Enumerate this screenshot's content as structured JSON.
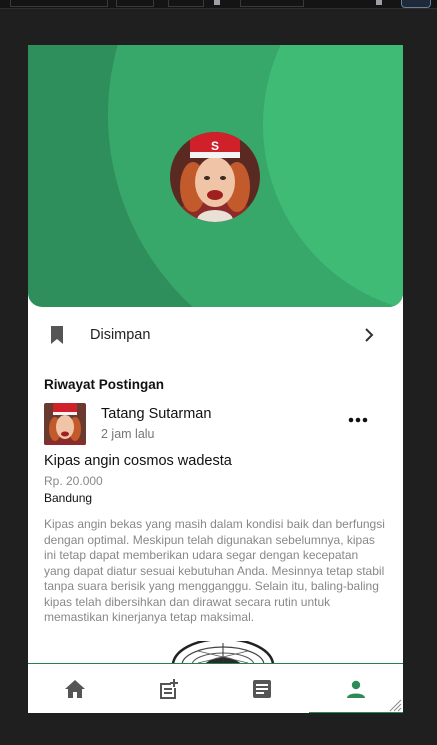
{
  "colors": {
    "header_dark": "#2f8f5c",
    "header_mid": "#37a76a",
    "header_light": "#3fbb76",
    "accent": "#2e8b57",
    "icon_gray": "#555555"
  },
  "profile": {
    "avatar_icon": "profile-photo"
  },
  "menu": {
    "saved_label": "Disimpan",
    "saved_icon": "bookmark-icon",
    "arrow_icon": "chevron-right-icon"
  },
  "history": {
    "section_title": "Riwayat Postingan",
    "post": {
      "author": "Tatang Sutarman",
      "time": "2 jam lalu",
      "title": "Kipas angin cosmos wadesta",
      "price": "Rp. 20.000",
      "location": "Bandung",
      "description": "Kipas angin bekas yang masih dalam kondisi baik dan berfungsi dengan optimal. Meskipun telah digunakan sebelumnya, kipas ini tetap dapat memberikan udara segar dengan kecepatan yang dapat diatur sesuai kebutuhan Anda. Mesinnya tetap stabil tanpa suara berisik yang mengganggu. Selain itu, baling-baling kipas telah dibersihkan dan dirawat secara rutin untuk memastikan kinerjanya tetap maksimal.",
      "more_icon": "more-horizontal-icon",
      "image_icon": "fan-photo"
    }
  },
  "nav": {
    "items": [
      {
        "icon": "home-icon",
        "active": false
      },
      {
        "icon": "add-post-icon",
        "active": false
      },
      {
        "icon": "article-icon",
        "active": false
      },
      {
        "icon": "person-icon",
        "active": true
      }
    ]
  }
}
